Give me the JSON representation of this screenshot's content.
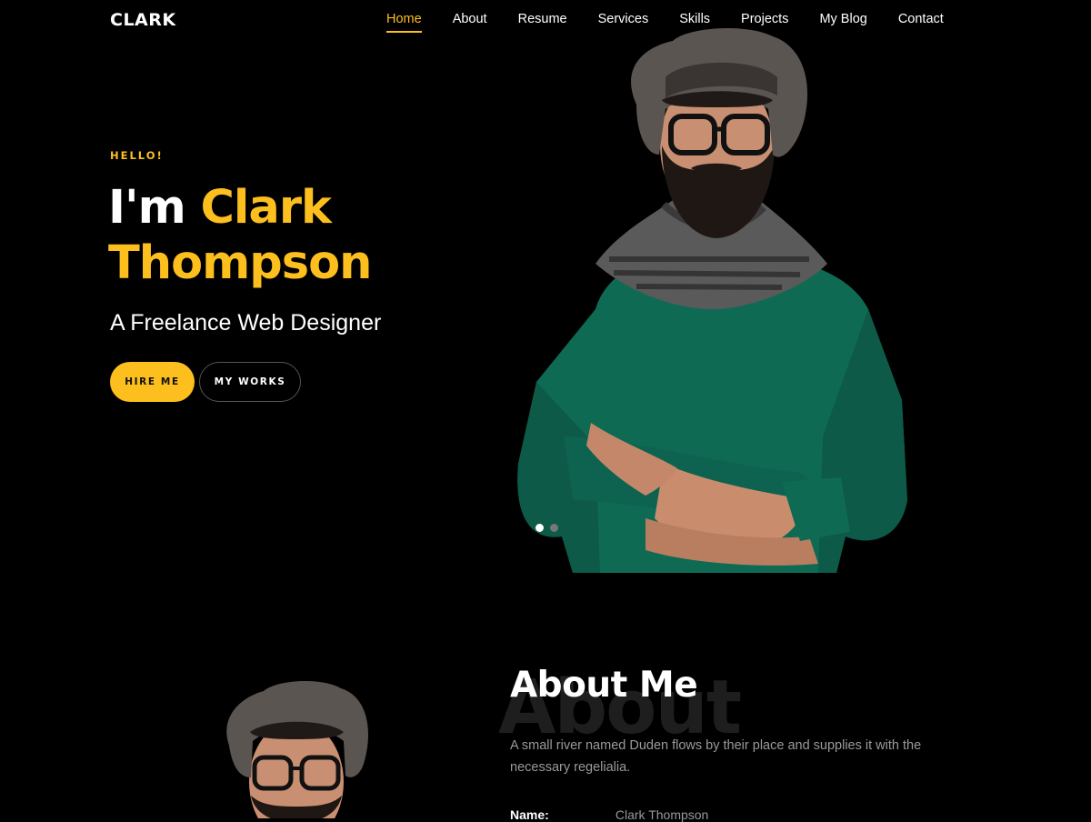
{
  "brand": {
    "logo": "CLARK"
  },
  "nav": {
    "items": [
      {
        "label": "Home",
        "active": true
      },
      {
        "label": "About",
        "active": false
      },
      {
        "label": "Resume",
        "active": false
      },
      {
        "label": "Services",
        "active": false
      },
      {
        "label": "Skills",
        "active": false
      },
      {
        "label": "Projects",
        "active": false
      },
      {
        "label": "My Blog",
        "active": false
      },
      {
        "label": "Contact",
        "active": false
      }
    ]
  },
  "hero": {
    "greeting": "HELLO!",
    "title_prefix": "I'm",
    "title_name_first": "Clark",
    "title_name_last": "Thompson",
    "subtitle": "A Freelance Web Designer",
    "buttons": {
      "primary": "HIRE ME",
      "secondary": "MY WORKS"
    },
    "slider": {
      "active_index": 0,
      "count": 2
    }
  },
  "about": {
    "watermark": "About",
    "title": "About Me",
    "text": "A small river named Duden flows by their place and supplies it with the necessary regelialia.",
    "info": [
      {
        "label": "Name:",
        "value": "Clark Thompson"
      }
    ]
  },
  "colors": {
    "accent": "#fcbf1e",
    "background": "#000000"
  }
}
